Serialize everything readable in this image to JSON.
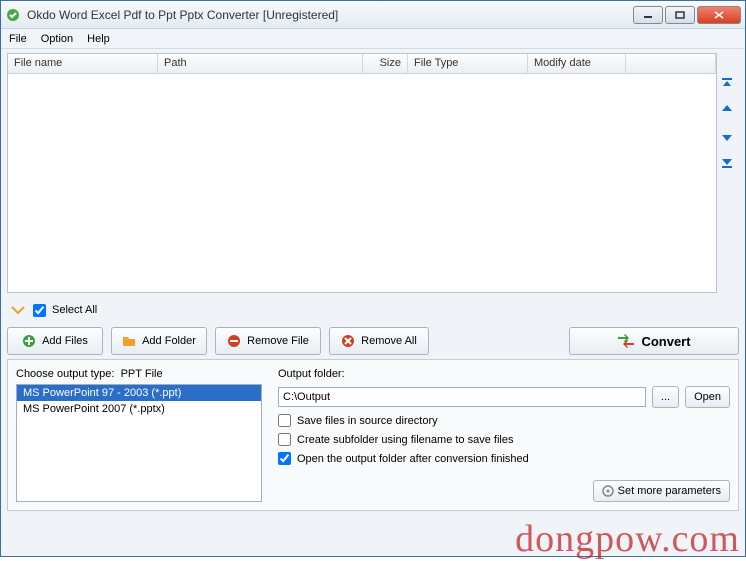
{
  "window": {
    "title": "Okdo Word Excel Pdf to Ppt Pptx Converter [Unregistered]"
  },
  "menu": {
    "file": "File",
    "option": "Option",
    "help": "Help"
  },
  "table": {
    "cols": {
      "filename": "File name",
      "path": "Path",
      "size": "Size",
      "filetype": "File Type",
      "modify": "Modify date"
    }
  },
  "selectAll": {
    "label": "Select All",
    "checked": true
  },
  "buttons": {
    "addFiles": "Add Files",
    "addFolder": "Add Folder",
    "removeFile": "Remove File",
    "removeAll": "Remove All",
    "convert": "Convert"
  },
  "output": {
    "typeLabelPrefix": "Choose output type:",
    "typeCurrent": "PPT File",
    "types": [
      "MS PowerPoint 97 - 2003 (*.ppt)",
      "MS PowerPoint 2007 (*.pptx)"
    ],
    "folderLabel": "Output folder:",
    "folderPath": "C:\\Output",
    "browse": "...",
    "open": "Open",
    "saveSource": "Save files in source directory",
    "saveSourceChecked": false,
    "createSub": "Create subfolder using filename to save files",
    "createSubChecked": false,
    "openAfter": "Open the output folder after conversion finished",
    "openAfterChecked": true,
    "moreParams": "Set more parameters"
  },
  "watermark": "dongpow.com"
}
